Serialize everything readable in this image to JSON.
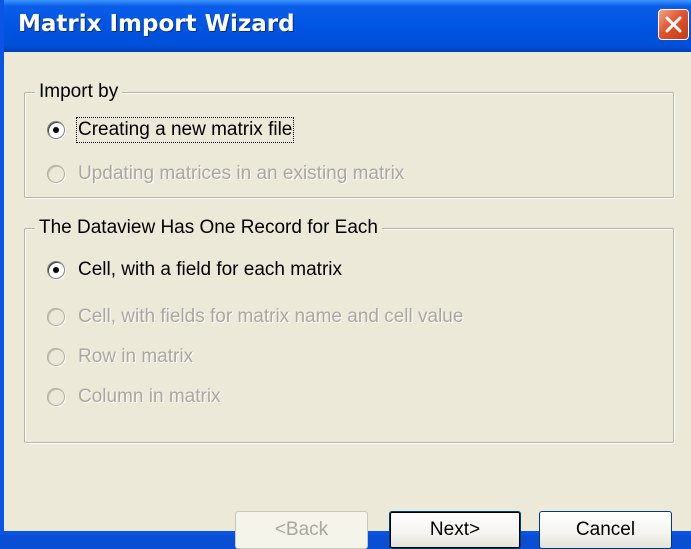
{
  "window": {
    "title": "Matrix Import Wizard"
  },
  "import_by": {
    "label": "Import by",
    "options": [
      {
        "label": "Creating a new matrix file",
        "checked": true,
        "enabled": true
      },
      {
        "label": "Updating matrices in an existing matrix",
        "checked": false,
        "enabled": false
      }
    ]
  },
  "record_type": {
    "label": "The Dataview Has One Record for Each",
    "options": [
      {
        "label": "Cell, with a field for each matrix",
        "checked": true,
        "enabled": true
      },
      {
        "label": "Cell, with fields for matrix name and cell value",
        "checked": false,
        "enabled": false
      },
      {
        "label": "Row in matrix",
        "checked": false,
        "enabled": false
      },
      {
        "label": "Column in matrix",
        "checked": false,
        "enabled": false
      }
    ]
  },
  "buttons": {
    "back": "<Back",
    "next": "Next>",
    "cancel": "Cancel"
  }
}
